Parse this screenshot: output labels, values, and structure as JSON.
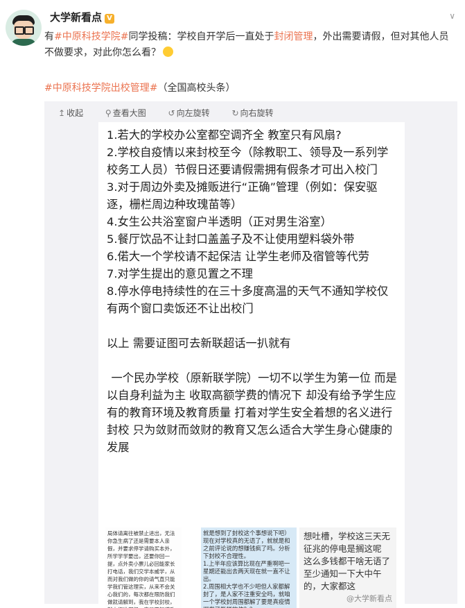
{
  "header": {
    "username": "大学新看点",
    "verified_badge": "V"
  },
  "post": {
    "prefix": "有",
    "tag_school": "#中原科技学院#",
    "text_part1": "同学投稿：学校自开学后一直处于",
    "link_keyword": "封闭管理",
    "text_part2": "，外出需要请假，但对其他人员不做要求，对此你怎么看？",
    "source_tag": "#中原科技学院出校管理#",
    "source_suffix": "（全国高校头条）"
  },
  "toolbar": {
    "collapse": "收起",
    "view_large": "查看大图",
    "rotate_left": "向左旋转",
    "rotate_right": "向右旋转"
  },
  "document": {
    "lines": [
      "1.若大的学校办公室都空调齐全 教室只有风扇?",
      "2.学校自疫情以来封校至今（除教职工、领导及一系列学校务工人员）节假日还要请假需拥有假条才可出入校门",
      "3.对于周边外卖及摊贩进行“正确”管理（例如：保安驱逐，栅栏周边种玫瑰苗等）",
      "4.女生公共浴室窗户半透明（正对男生浴室）",
      "5.餐厅饮品不让封口盖盖子及不让使用塑料袋外带",
      "6.偌大一个学校请不起保洁 让学生老师及宿管等代劳",
      "7.对学生提出的意见置之不理",
      "8.停水停电持续性的在三十多度高温的天气不通知学校仅有两个窗口卖饭还不让出校门"
    ],
    "note": "以上 需要证图可去新联超话一扒就有",
    "para": "一个民办学校（原新联学院）一切不以学生为第一位 而是以自身利益为主 收取高额学费的情况下 却没有给予学生应有的教育环境及教育质量 打着对学生安全着想的名义进行封校 只为敛财而敛财的教育又怎么适合大学生身心健康的发展"
  },
  "thumbnails": {
    "t1": "局体请离往被禁止进出，无法你急生病了还是需要本人亲假，并要求停学请购买本外，所学学学要出，还要你回一提，点外卖小票儿必回能家长打电话，我们交学本威学，从而对我们做的你的请气直只能学我们管这理实，从来不会关心我们的，每次都在限防我们做就请解到，我在学校封校，就上很准都很，真是不知道政自己去办，有点事情需要出门都…",
    "t2": "就是想到了封校这个事想说下吧）现在对学校真的无语了，就就是和之前评论说的想赚钱疯了吗。分析下封校不合理性。\n1.上半年应该算比现在严重啊吧一星期还能出去两天现在就一直不让出。\n2.周围相大学也不少吧但人家都解封了，是人家不注重安全吗，就咱一个学校封周围都解了要是真疫情爆发了能拦的住？？",
    "t3": "想吐槽，学校这三天无征兆的停电是搁这呢 这么多钱都干啥无语了 至少通知一下大中午的，大家都这",
    "watermark": "@大学新看点"
  },
  "colors": {
    "accent": "#eb7350",
    "badge": "#f6b02c"
  },
  "icons": [
    "avatar",
    "verified-icon",
    "chevron-down-icon",
    "emoji-icon",
    "collapse-icon",
    "search-icon",
    "rotate-left-icon",
    "rotate-right-icon"
  ]
}
